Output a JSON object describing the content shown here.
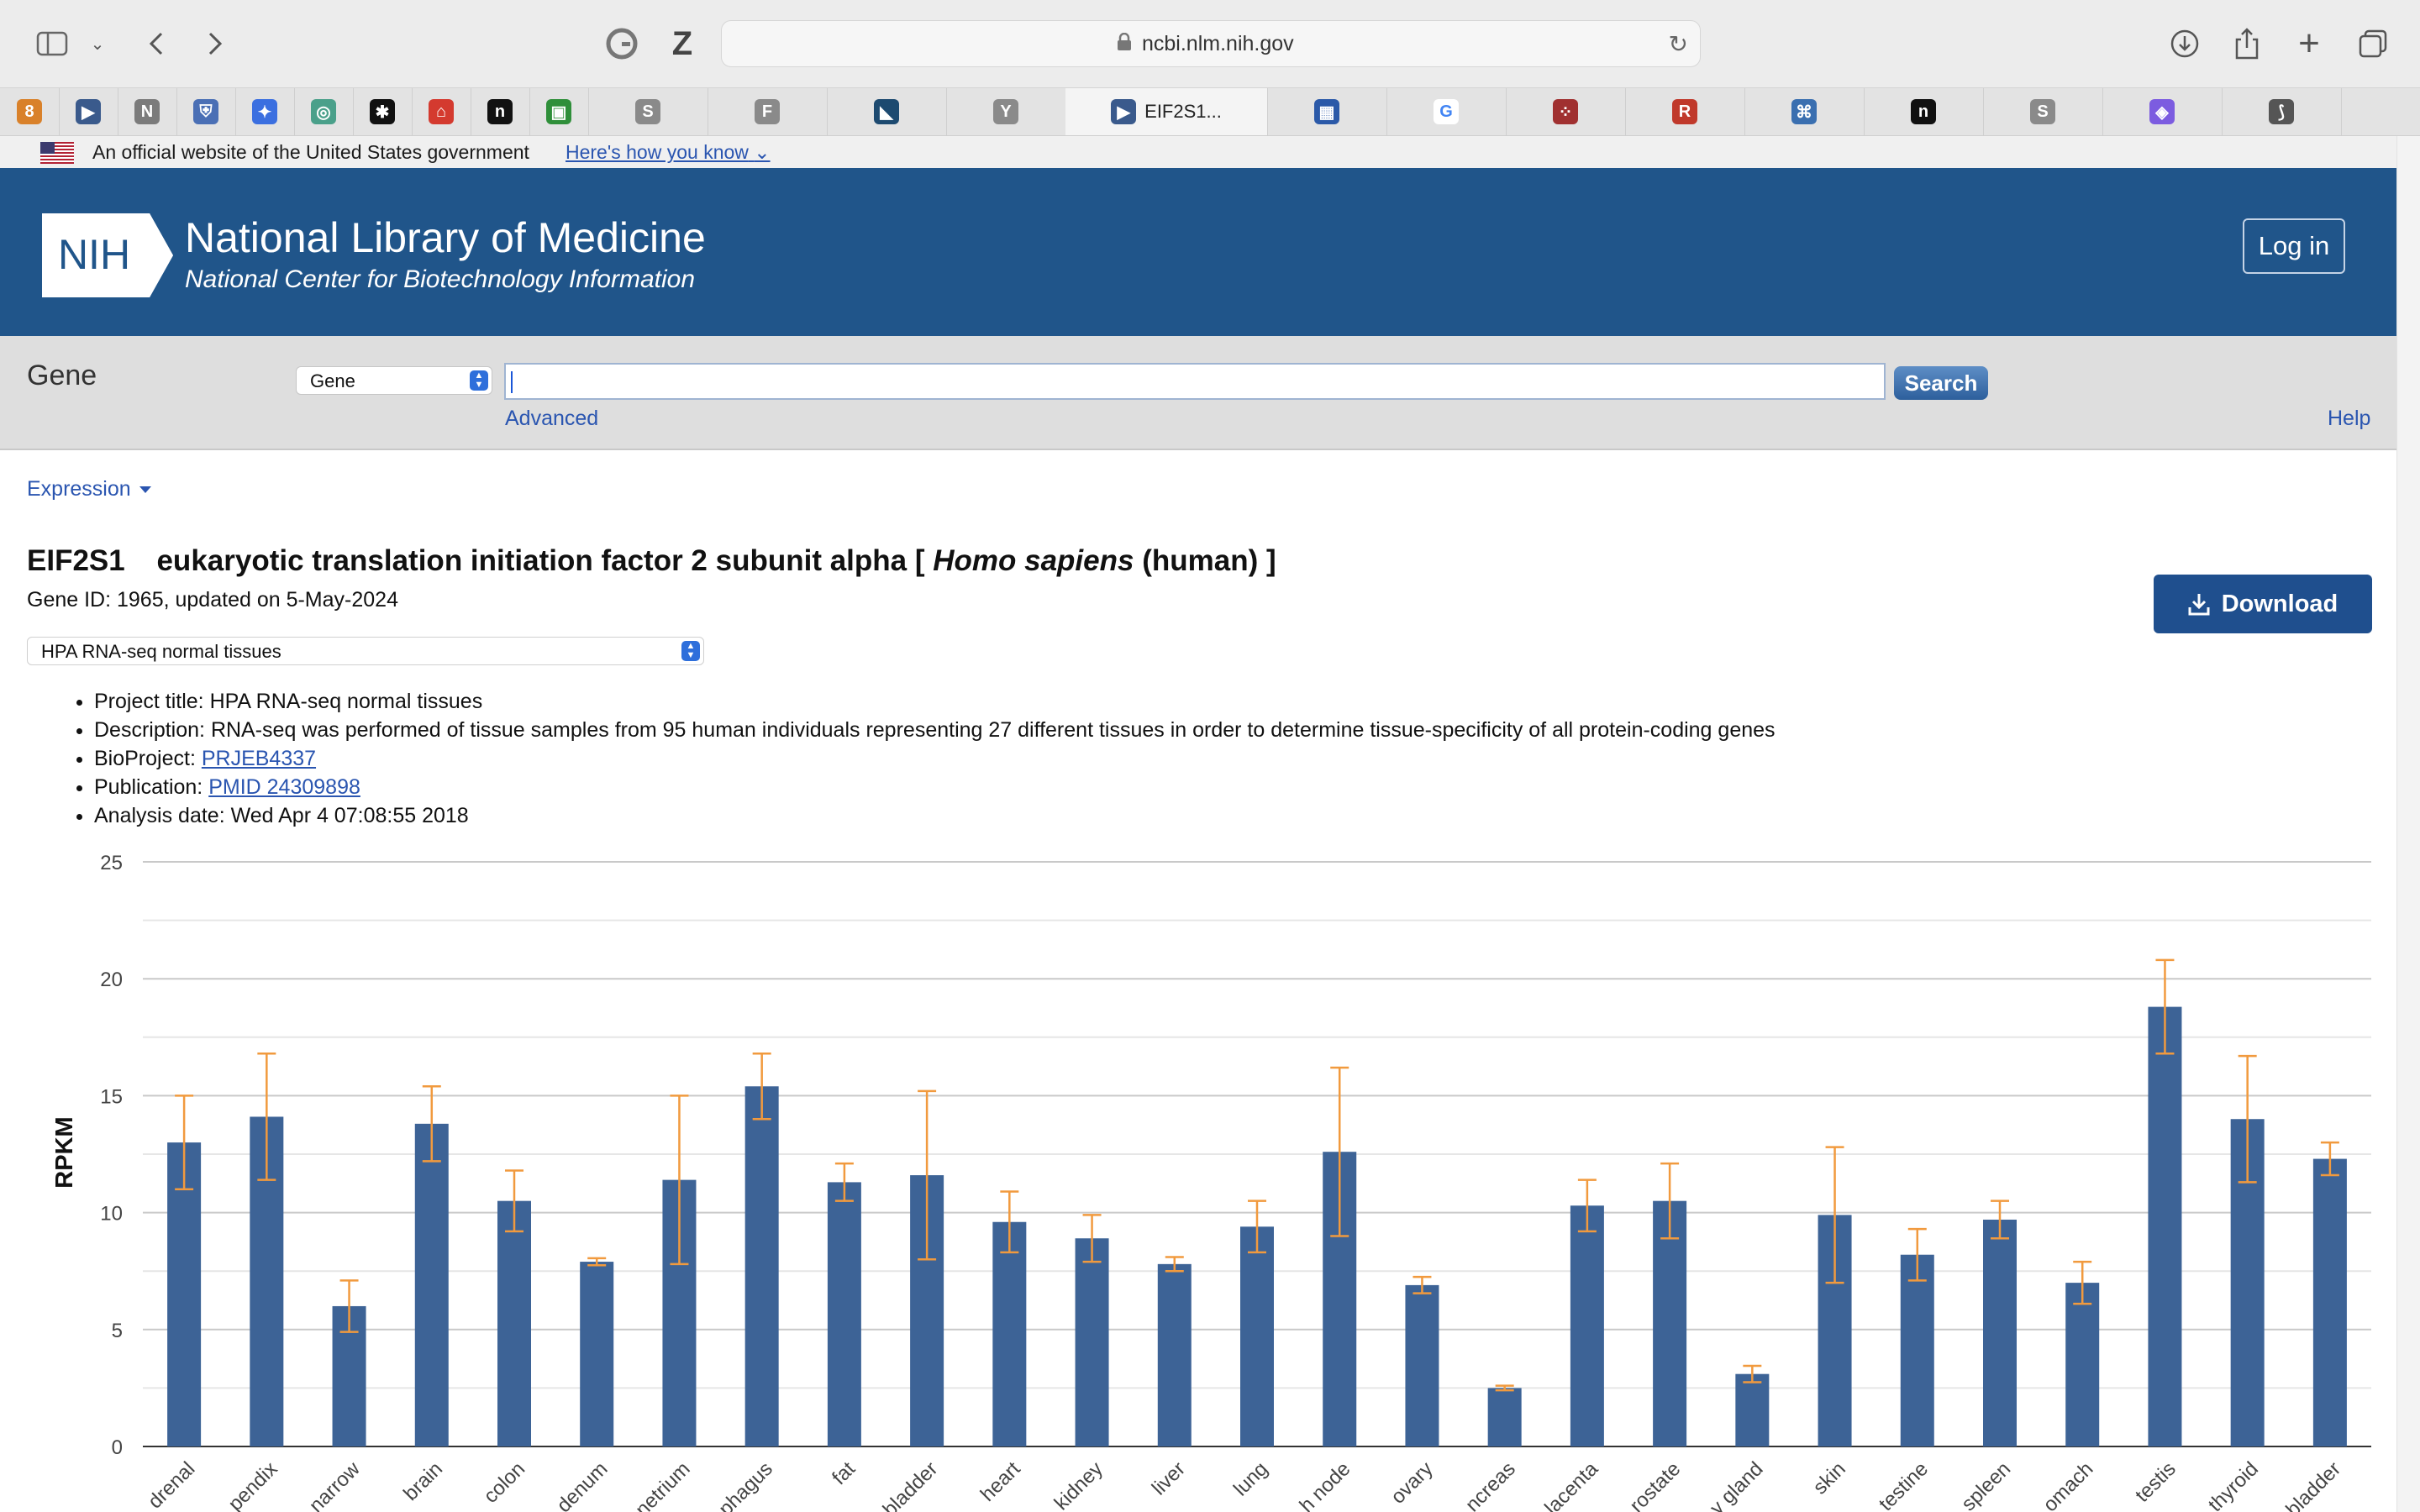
{
  "browser": {
    "url": "ncbi.nlm.nih.gov",
    "tabs": [
      {
        "label": "",
        "icon": "orange-circle-icon",
        "color": "#d9812a",
        "glyph": "8"
      },
      {
        "label": "",
        "icon": "pubmed-icon",
        "color": "#3a5a8c",
        "glyph": "▶"
      },
      {
        "label": "",
        "icon": "notion-n-icon",
        "color": "#7b7b7b",
        "glyph": "N"
      },
      {
        "label": "",
        "icon": "shield-icon",
        "color": "#4a6fb5",
        "glyph": "⛨"
      },
      {
        "label": "",
        "icon": "sparkle-icon",
        "color": "#3b6fe0",
        "glyph": "✦"
      },
      {
        "label": "",
        "icon": "openai-icon",
        "color": "#4aa08a",
        "glyph": "◎"
      },
      {
        "label": "",
        "icon": "network-icon",
        "color": "#111111",
        "glyph": "✱"
      },
      {
        "label": "",
        "icon": "pdf-icon",
        "color": "#d43a2f",
        "glyph": "⌂"
      },
      {
        "label": "",
        "icon": "n-circle-icon",
        "color": "#111111",
        "glyph": "n"
      },
      {
        "label": "",
        "icon": "classroom-icon",
        "color": "#2f8f3a",
        "glyph": "▣"
      },
      {
        "label": "",
        "icon": "s-icon",
        "color": "#8a8a8a",
        "glyph": "S"
      },
      {
        "label": "",
        "icon": "f-icon",
        "color": "#8a8a8a",
        "glyph": "F"
      },
      {
        "label": "",
        "icon": "triangle-icon",
        "color": "#1d4a70",
        "glyph": "◣"
      },
      {
        "label": "",
        "icon": "y-icon",
        "color": "#8a8a8a",
        "glyph": "Y"
      },
      {
        "label": "EIF2S1...",
        "icon": "ncbi-tab-icon",
        "color": "#3a5a8c",
        "glyph": "▶"
      },
      {
        "label": "",
        "icon": "grid-icon",
        "color": "#2b59a8",
        "glyph": "▦"
      },
      {
        "label": "",
        "icon": "google-icon",
        "color": "#ffffff",
        "glyph": "G"
      },
      {
        "label": "",
        "icon": "dots-icon",
        "color": "#a03030",
        "glyph": "⁘"
      },
      {
        "label": "",
        "icon": "r-icon",
        "color": "#c0392b",
        "glyph": "R"
      },
      {
        "label": "",
        "icon": "institute-icon",
        "color": "#3a6fb0",
        "glyph": "⌘"
      },
      {
        "label": "",
        "icon": "n-circle-icon",
        "color": "#111111",
        "glyph": "n"
      },
      {
        "label": "",
        "icon": "s-icon",
        "color": "#8a8a8a",
        "glyph": "S"
      },
      {
        "label": "",
        "icon": "app-icon",
        "color": "#7c5ce0",
        "glyph": "◈"
      },
      {
        "label": "",
        "icon": "link-icon",
        "color": "#555555",
        "glyph": "⟆"
      }
    ]
  },
  "gov_banner": {
    "official": "An official website of the United States government",
    "how_link": "Here's how you know"
  },
  "header": {
    "logo_text": "NIH",
    "title": "National Library of Medicine",
    "subtitle": "National Center for Biotechnology Information",
    "login": "Log in"
  },
  "search": {
    "db_label": "Gene",
    "db_selected": "Gene",
    "query": "",
    "button": "Search",
    "advanced": "Advanced",
    "help": "Help"
  },
  "nav": {
    "expression": "Expression"
  },
  "gene": {
    "symbol": "EIF2S1",
    "name_prefix": "eukaryotic translation initiation factor 2 subunit alpha [",
    "organism": "Homo sapiens",
    "name_suffix": "(human) ]",
    "meta": "Gene ID: 1965, updated on 5-May-2024"
  },
  "dataset": {
    "selected": "HPA RNA-seq normal tissues"
  },
  "download": {
    "label": "Download"
  },
  "project": {
    "title_label": "Project title:",
    "title_value": "HPA RNA-seq normal tissues",
    "description_label": "Description:",
    "description_value": "RNA-seq was performed of tissue samples from 95 human individuals representing 27 different tissues in order to determine tissue-specificity of all protein-coding genes",
    "bioproject_label": "BioProject:",
    "bioproject_link": "PRJEB4337",
    "publication_label": "Publication:",
    "publication_link": "PMID 24309898",
    "analysis_label": "Analysis date:",
    "analysis_value": "Wed Apr 4 07:08:55 2018"
  },
  "colors": {
    "bar": "#3d6396",
    "error": "#f19a3e",
    "header": "#20558a"
  },
  "chart_data": {
    "type": "bar",
    "title": "",
    "xlabel": "",
    "ylabel": "RPKM",
    "ylim": [
      0,
      25
    ],
    "yticks": [
      0,
      5,
      10,
      15,
      20,
      25
    ],
    "categories": [
      "drenal",
      "pendix",
      "narrow",
      "brain",
      "colon",
      "denum",
      "netrium",
      "phagus",
      "fat",
      "bladder",
      "heart",
      "kidney",
      "liver",
      "lung",
      "h node",
      "ovary",
      "ncreas",
      "lacenta",
      "rostate",
      "y gland",
      "skin",
      "testine",
      "spleen",
      "omach",
      "testis",
      "thyroid",
      "bladder"
    ],
    "values": [
      13.0,
      14.1,
      6.0,
      13.8,
      10.5,
      7.9,
      11.4,
      15.4,
      11.3,
      11.6,
      9.6,
      8.9,
      7.8,
      9.4,
      12.6,
      6.9,
      2.5,
      10.3,
      10.5,
      3.1,
      9.9,
      8.2,
      9.7,
      7.0,
      18.8,
      14.0,
      12.3
    ],
    "errors": [
      2.0,
      2.7,
      1.1,
      1.6,
      1.3,
      0.15,
      3.6,
      1.4,
      0.8,
      3.6,
      1.3,
      1.0,
      0.3,
      1.1,
      3.6,
      0.35,
      0.1,
      1.1,
      1.6,
      0.35,
      2.9,
      1.1,
      0.8,
      0.9,
      2.0,
      2.7,
      0.7
    ],
    "grid": true
  }
}
